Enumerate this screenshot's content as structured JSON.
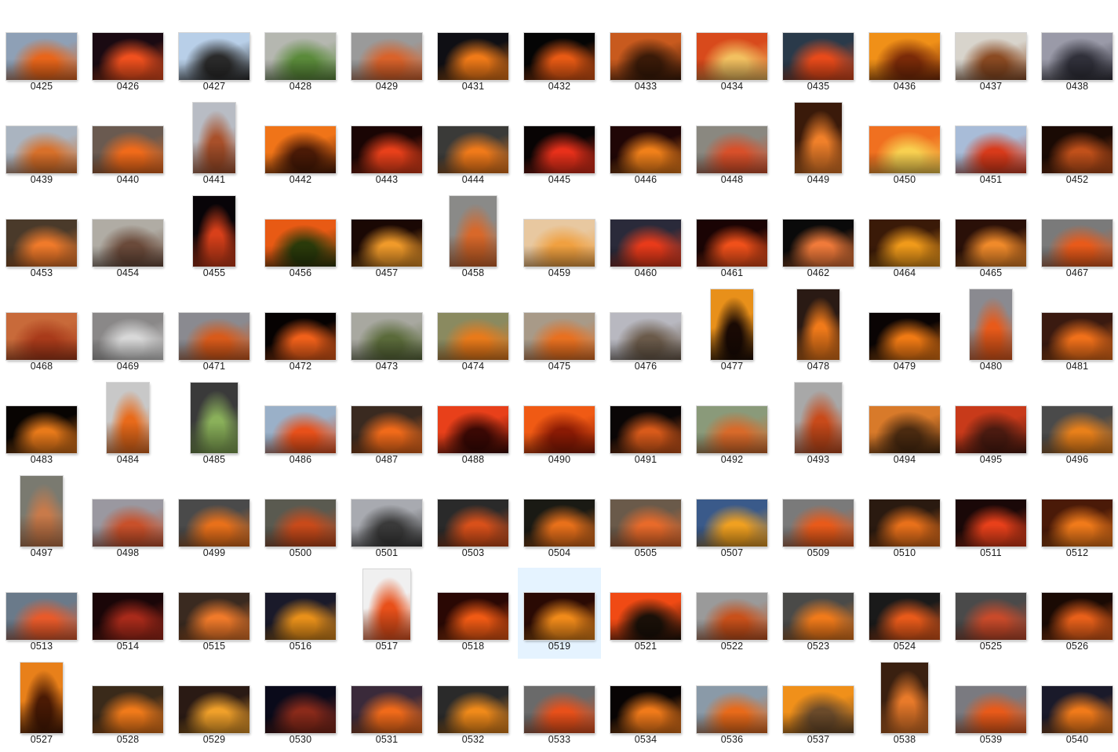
{
  "selected": "0519",
  "files": [
    {
      "name": "0425",
      "c1": "#8ea0b6",
      "c2": "#e8651a",
      "o": "l"
    },
    {
      "name": "0426",
      "c1": "#1a0a12",
      "c2": "#f0501e",
      "o": "l"
    },
    {
      "name": "0427",
      "c1": "#b8cfe8",
      "c2": "#2a2a2a",
      "o": "l"
    },
    {
      "name": "0428",
      "c1": "#b5b7b0",
      "c2": "#5a8a3a",
      "o": "l"
    },
    {
      "name": "0429",
      "c1": "#9a9a9a",
      "c2": "#d9622a",
      "o": "l"
    },
    {
      "name": "0431",
      "c1": "#0f0f14",
      "c2": "#f07a18",
      "o": "l"
    },
    {
      "name": "0432",
      "c1": "#050505",
      "c2": "#e85a14",
      "o": "l"
    },
    {
      "name": "0433",
      "c1": "#c85a1e",
      "c2": "#3a1a08",
      "o": "l"
    },
    {
      "name": "0434",
      "c1": "#d84a1c",
      "c2": "#f2c060",
      "o": "l"
    },
    {
      "name": "0435",
      "c1": "#2a3a4a",
      "c2": "#e84a1a",
      "o": "l"
    },
    {
      "name": "0436",
      "c1": "#f09018",
      "c2": "#7a2a08",
      "o": "l"
    },
    {
      "name": "0437",
      "c1": "#d8d4cc",
      "c2": "#8a4a22",
      "o": "l"
    },
    {
      "name": "0438",
      "c1": "#9a9aa8",
      "c2": "#30303a",
      "o": "l"
    },
    {
      "name": "0439",
      "c1": "#aab4c0",
      "c2": "#d8702a",
      "o": "l"
    },
    {
      "name": "0440",
      "c1": "#6a5a50",
      "c2": "#f06a1a",
      "o": "l"
    },
    {
      "name": "0441",
      "c1": "#b8bcc4",
      "c2": "#a8502a",
      "o": "t"
    },
    {
      "name": "0442",
      "c1": "#f07418",
      "c2": "#4a1a06",
      "o": "l"
    },
    {
      "name": "0443",
      "c1": "#1a0504",
      "c2": "#e8401a",
      "o": "l"
    },
    {
      "name": "0444",
      "c1": "#3a3a38",
      "c2": "#f07a1a",
      "o": "l"
    },
    {
      "name": "0445",
      "c1": "#080404",
      "c2": "#e8301a",
      "o": "l"
    },
    {
      "name": "0446",
      "c1": "#200606",
      "c2": "#f0801a",
      "o": "l"
    },
    {
      "name": "0448",
      "c1": "#8a8880",
      "c2": "#d8502a",
      "o": "l"
    },
    {
      "name": "0449",
      "c1": "#3a1a0a",
      "c2": "#f0802a",
      "o": "p"
    },
    {
      "name": "0450",
      "c1": "#f07020",
      "c2": "#f8d050",
      "o": "l"
    },
    {
      "name": "0451",
      "c1": "#a8bcd8",
      "c2": "#d83a1a",
      "o": "l"
    },
    {
      "name": "0452",
      "c1": "#1a0a04",
      "c2": "#c0501a",
      "o": "l"
    },
    {
      "name": "0453",
      "c1": "#4a3a2a",
      "c2": "#f07a2a",
      "o": "l"
    },
    {
      "name": "0454",
      "c1": "#b0aca4",
      "c2": "#6a4a3a",
      "o": "l"
    },
    {
      "name": "0455",
      "c1": "#080408",
      "c2": "#d8401a",
      "o": "t"
    },
    {
      "name": "0456",
      "c1": "#e85a14",
      "c2": "#2a3a0a",
      "o": "l"
    },
    {
      "name": "0457",
      "c1": "#1a0804",
      "c2": "#f09a2a",
      "o": "l"
    },
    {
      "name": "0458",
      "c1": "#8a8a88",
      "c2": "#d8682a",
      "o": "p"
    },
    {
      "name": "0459",
      "c1": "#e8c8a0",
      "c2": "#f0a040",
      "o": "l"
    },
    {
      "name": "0460",
      "c1": "#2a2a3a",
      "c2": "#e83a1a",
      "o": "l"
    },
    {
      "name": "0461",
      "c1": "#1a0404",
      "c2": "#f0501a",
      "o": "l"
    },
    {
      "name": "0462",
      "c1": "#0a0a0a",
      "c2": "#f07a3a",
      "o": "l"
    },
    {
      "name": "0464",
      "c1": "#3a1a08",
      "c2": "#f09a1a",
      "o": "l"
    },
    {
      "name": "0465",
      "c1": "#2a1008",
      "c2": "#f08a2a",
      "o": "l"
    },
    {
      "name": "0467",
      "c1": "#7a7a7a",
      "c2": "#e85a1a",
      "o": "l"
    },
    {
      "name": "0468",
      "c1": "#c86a3a",
      "c2": "#a83a1a",
      "o": "l"
    },
    {
      "name": "0469",
      "c1": "#8a8888",
      "c2": "#d8d8d8",
      "o": "l"
    },
    {
      "name": "0471",
      "c1": "#8a8a90",
      "c2": "#d85a1a",
      "o": "l"
    },
    {
      "name": "0472",
      "c1": "#060202",
      "c2": "#f0601a",
      "o": "l"
    },
    {
      "name": "0473",
      "c1": "#a8a8a0",
      "c2": "#5a6a3a",
      "o": "l"
    },
    {
      "name": "0474",
      "c1": "#8a8a60",
      "c2": "#e87a1a",
      "o": "l"
    },
    {
      "name": "0475",
      "c1": "#a89a88",
      "c2": "#e87020",
      "o": "l"
    },
    {
      "name": "0476",
      "c1": "#b8b8c0",
      "c2": "#6a5a4a",
      "o": "l"
    },
    {
      "name": "0477",
      "c1": "#e8901a",
      "c2": "#1a0a04",
      "o": "t"
    },
    {
      "name": "0478",
      "c1": "#2a1a14",
      "c2": "#f07a1a",
      "o": "t"
    },
    {
      "name": "0479",
      "c1": "#0a0404",
      "c2": "#f07a14",
      "o": "l"
    },
    {
      "name": "0480",
      "c1": "#8a8a90",
      "c2": "#e85a1a",
      "o": "t"
    },
    {
      "name": "0481",
      "c1": "#3a1a10",
      "c2": "#f0701a",
      "o": "l"
    },
    {
      "name": "0483",
      "c1": "#080402",
      "c2": "#e87a1a",
      "o": "l"
    },
    {
      "name": "0484",
      "c1": "#c8c8c8",
      "c2": "#e86a1a",
      "o": "t"
    },
    {
      "name": "0485",
      "c1": "#3a3a3a",
      "c2": "#8ab05a",
      "o": "p"
    },
    {
      "name": "0486",
      "c1": "#9ab0c8",
      "c2": "#e8501a",
      "o": "l"
    },
    {
      "name": "0487",
      "c1": "#3a2a20",
      "c2": "#f06a1a",
      "o": "l"
    },
    {
      "name": "0488",
      "c1": "#e8401a",
      "c2": "#3a0804",
      "o": "l"
    },
    {
      "name": "0490",
      "c1": "#f05a14",
      "c2": "#8a1a04",
      "o": "l"
    },
    {
      "name": "0491",
      "c1": "#0a0606",
      "c2": "#d85a1a",
      "o": "l"
    },
    {
      "name": "0492",
      "c1": "#8a9a7a",
      "c2": "#d86a2a",
      "o": "l"
    },
    {
      "name": "0493",
      "c1": "#a8a8a8",
      "c2": "#c84a1a",
      "o": "p"
    },
    {
      "name": "0494",
      "c1": "#d87a2a",
      "c2": "#4a2a10",
      "o": "l"
    },
    {
      "name": "0495",
      "c1": "#c83a1a",
      "c2": "#4a1a10",
      "o": "l"
    },
    {
      "name": "0496",
      "c1": "#4a4a4a",
      "c2": "#e8801a",
      "o": "l"
    },
    {
      "name": "0497",
      "c1": "#7a7a70",
      "c2": "#c87a4a",
      "o": "t"
    },
    {
      "name": "0498",
      "c1": "#9a98a0",
      "c2": "#c8502a",
      "o": "l"
    },
    {
      "name": "0499",
      "c1": "#4a4a4a",
      "c2": "#e8701a",
      "o": "l"
    },
    {
      "name": "0500",
      "c1": "#5a5a50",
      "c2": "#c84a1a",
      "o": "l"
    },
    {
      "name": "0501",
      "c1": "#a8aab0",
      "c2": "#3a3a3a",
      "o": "l"
    },
    {
      "name": "0503",
      "c1": "#2a2a2a",
      "c2": "#d8501a",
      "o": "l"
    },
    {
      "name": "0504",
      "c1": "#1a1a14",
      "c2": "#e8701a",
      "o": "l"
    },
    {
      "name": "0505",
      "c1": "#6a5a4a",
      "c2": "#e86a2a",
      "o": "l"
    },
    {
      "name": "0507",
      "c1": "#3a5a8a",
      "c2": "#f0a020",
      "o": "l"
    },
    {
      "name": "0509",
      "c1": "#7a7a7a",
      "c2": "#e85a1a",
      "o": "l"
    },
    {
      "name": "0510",
      "c1": "#2a1a10",
      "c2": "#e8701a",
      "o": "l"
    },
    {
      "name": "0511",
      "c1": "#1a0808",
      "c2": "#e8401a",
      "o": "l"
    },
    {
      "name": "0512",
      "c1": "#4a1a08",
      "c2": "#f07a1a",
      "o": "l"
    },
    {
      "name": "0513",
      "c1": "#6a7a8a",
      "c2": "#e85a2a",
      "o": "l"
    },
    {
      "name": "0514",
      "c1": "#1a0608",
      "c2": "#a82a1a",
      "o": "l"
    },
    {
      "name": "0515",
      "c1": "#3a2a20",
      "c2": "#f07a2a",
      "o": "l"
    },
    {
      "name": "0516",
      "c1": "#1a1a2a",
      "c2": "#e8901a",
      "o": "l"
    },
    {
      "name": "0517",
      "c1": "#f0f0f0",
      "c2": "#e8501a",
      "o": "p"
    },
    {
      "name": "0518",
      "c1": "#2a0804",
      "c2": "#f05a14",
      "o": "l"
    },
    {
      "name": "0519",
      "c1": "#2a0a04",
      "c2": "#f08a1a",
      "o": "l"
    },
    {
      "name": "0521",
      "c1": "#f04a14",
      "c2": "#1a1008",
      "o": "l"
    },
    {
      "name": "0522",
      "c1": "#9a9a9a",
      "c2": "#c8501a",
      "o": "l"
    },
    {
      "name": "0523",
      "c1": "#4a4a48",
      "c2": "#f07a1a",
      "o": "l"
    },
    {
      "name": "0524",
      "c1": "#1a1a1a",
      "c2": "#e85a1a",
      "o": "l"
    },
    {
      "name": "0525",
      "c1": "#4a4a4a",
      "c2": "#c84a2a",
      "o": "l"
    },
    {
      "name": "0526",
      "c1": "#1a0a04",
      "c2": "#e8601a",
      "o": "l"
    },
    {
      "name": "0527",
      "c1": "#e8801a",
      "c2": "#4a1a04",
      "o": "t"
    },
    {
      "name": "0528",
      "c1": "#3a2a1a",
      "c2": "#f07a1a",
      "o": "l"
    },
    {
      "name": "0529",
      "c1": "#2a1a14",
      "c2": "#f0a02a",
      "o": "l"
    },
    {
      "name": "0530",
      "c1": "#0a0a1a",
      "c2": "#8a2a1a",
      "o": "l"
    },
    {
      "name": "0531",
      "c1": "#3a2a3a",
      "c2": "#f06a1a",
      "o": "l"
    },
    {
      "name": "0532",
      "c1": "#2a2a2a",
      "c2": "#f08a1a",
      "o": "l"
    },
    {
      "name": "0533",
      "c1": "#6a6a6a",
      "c2": "#e8501a",
      "o": "l"
    },
    {
      "name": "0534",
      "c1": "#080404",
      "c2": "#f07a1a",
      "o": "l"
    },
    {
      "name": "0536",
      "c1": "#8a9aa8",
      "c2": "#e86a1a",
      "o": "l"
    },
    {
      "name": "0537",
      "c1": "#f0901a",
      "c2": "#6a4a2a",
      "o": "l"
    },
    {
      "name": "0538",
      "c1": "#3a2010",
      "c2": "#e87a2a",
      "o": "p"
    },
    {
      "name": "0539",
      "c1": "#7a7a80",
      "c2": "#e85a1a",
      "o": "l"
    },
    {
      "name": "0540",
      "c1": "#1a1a2a",
      "c2": "#f07a1a",
      "o": "l"
    }
  ]
}
